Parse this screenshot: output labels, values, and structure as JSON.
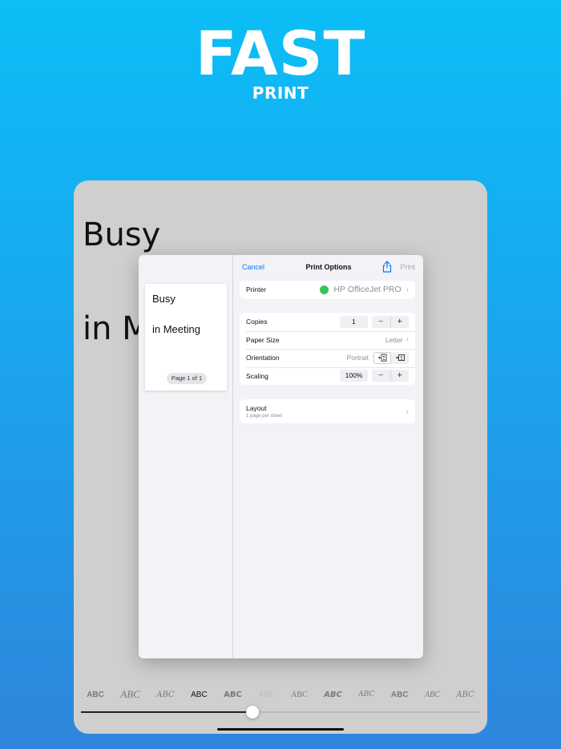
{
  "promo": {
    "headline": "FAST",
    "subhead": "PRINT"
  },
  "document": {
    "line1": "Busy",
    "line2": "in M"
  },
  "preview": {
    "line1": "Busy",
    "line2": "in Meeting",
    "page_counter": "Page 1 of 1"
  },
  "print_options": {
    "cancel": "Cancel",
    "title": "Print Options",
    "print": "Print",
    "printer": {
      "label": "Printer",
      "value": "HP OfficeJet PRO",
      "status_color": "#34c759"
    },
    "copies": {
      "label": "Copies",
      "value": "1",
      "minus": "−",
      "plus": "+"
    },
    "paper_size": {
      "label": "Paper Size",
      "value": "Letter"
    },
    "orientation": {
      "label": "Orientation",
      "value": "Portrait"
    },
    "scaling": {
      "label": "Scaling",
      "value": "100%",
      "minus": "−",
      "plus": "+"
    },
    "layout": {
      "label": "Layout",
      "sub": "1 page per sheet"
    }
  },
  "font_strip": {
    "items": [
      "ABC",
      "ABC",
      "ABC",
      "ABC",
      "ABC",
      "ABC",
      "ABC",
      "ABC",
      "ABC",
      "ABC",
      "ABC",
      "ABC"
    ],
    "active_index": 3
  },
  "slider": {
    "value": 0.43
  },
  "colors": {
    "accent": "#007aff",
    "status_green": "#34c759"
  }
}
